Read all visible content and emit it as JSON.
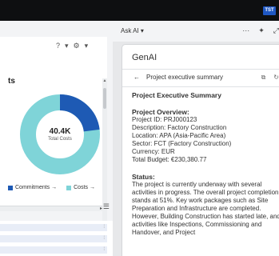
{
  "header": {
    "badge": "TST"
  },
  "left_panel": {
    "card_title": "ts",
    "toolbar": {
      "help_icon": "?",
      "settings_icon": "⚙"
    },
    "donut": {
      "value": "40.4K",
      "label": "Total Costs",
      "segments": [
        {
          "name": "Commitments",
          "fraction": 0.23,
          "color": "#1e5ab4"
        },
        {
          "name": "Costs",
          "fraction": 0.77,
          "color": "#7fd4d8"
        }
      ]
    },
    "legend": [
      {
        "label": "Commitments →",
        "color": "#1e5ab4"
      },
      {
        "label": "Costs →",
        "color": "#7fd4d8"
      }
    ]
  },
  "ask_ai": {
    "label": "Ask AI ▾",
    "more": "···",
    "pin": "📌",
    "expand": "⤢"
  },
  "genai": {
    "title": "GenAI",
    "back_label": "Project executive summary",
    "heading": "Project Executive Summary",
    "overview_heading": "Project Overview:",
    "overview_lines": [
      "Project ID: PRJ000123",
      "Description: Factory Construction",
      "Location: APA (Asia-Pacific Area)",
      "Sector: FCT (Factory Construction)",
      "Currency: EUR",
      "Total Budget: €230,380.77"
    ],
    "status_heading": "Status:",
    "status_text": "The project is currently underway with several activities in progress. The overall project completion stands at 51%. Key work packages such as Site Preparation and Infrastructure are completed. However, Building Construction has started late, and activities like Inspections, Commissioning and Handover, and Project"
  }
}
